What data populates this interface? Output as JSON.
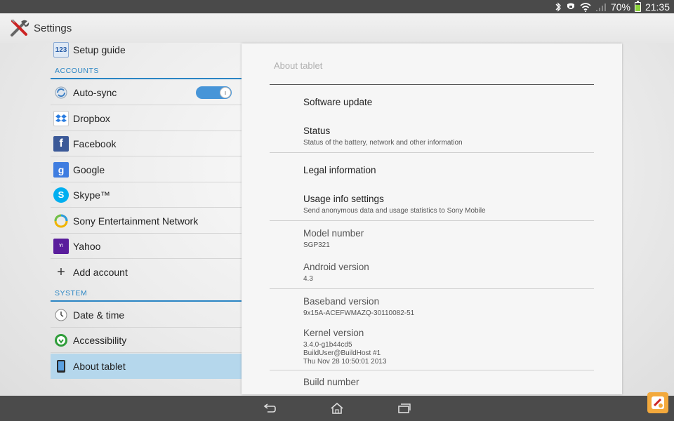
{
  "status_bar": {
    "battery": "70%",
    "time": "21:35"
  },
  "action_bar": {
    "title": "Settings"
  },
  "left_list": {
    "setup_guide": {
      "label": "Setup guide",
      "icon_text": "123"
    },
    "accounts_header": "ACCOUNTS",
    "accounts": [
      {
        "label": "Auto-sync",
        "icon": "sync-icon"
      },
      {
        "label": "Dropbox",
        "icon": "dropbox-icon"
      },
      {
        "label": "Facebook",
        "icon": "facebook-icon"
      },
      {
        "label": "Google",
        "icon": "google-icon"
      },
      {
        "label": "Skype™",
        "icon": "skype-icon"
      },
      {
        "label": "Sony Entertainment Network",
        "icon": "sony-entertainment-icon"
      },
      {
        "label": "Yahoo",
        "icon": "yahoo-icon"
      },
      {
        "label": "Add account",
        "icon": "plus-icon"
      }
    ],
    "system_header": "SYSTEM",
    "system": [
      {
        "label": "Date & time",
        "icon": "clock-icon"
      },
      {
        "label": "Accessibility",
        "icon": "accessibility-icon"
      },
      {
        "label": "About tablet",
        "icon": "tablet-icon",
        "selected": true
      }
    ]
  },
  "panel": {
    "title": "About tablet",
    "items": [
      {
        "title": "Software update",
        "sub": ""
      },
      {
        "title": "Status",
        "sub": "Status of the battery, network and other information"
      },
      {
        "title": "Legal information",
        "sub": ""
      },
      {
        "title": "Usage info settings",
        "sub": "Send anonymous data and usage statistics to Sony Mobile"
      },
      {
        "title": "Model number",
        "sub": "SGP321"
      },
      {
        "title": "Android version",
        "sub": "4.3"
      },
      {
        "title": "Baseband version",
        "sub": "9x15A-ACEFWMAZQ-30110082-51"
      },
      {
        "title": "Kernel version",
        "sub1": "3.4.0-g1b44cd5",
        "sub2": "BuildUser@BuildHost #1",
        "sub3": "Thu Nov 28 10:50:01 2013"
      },
      {
        "title": "Build number",
        "sub": ""
      }
    ]
  },
  "auto_sync_on": true
}
